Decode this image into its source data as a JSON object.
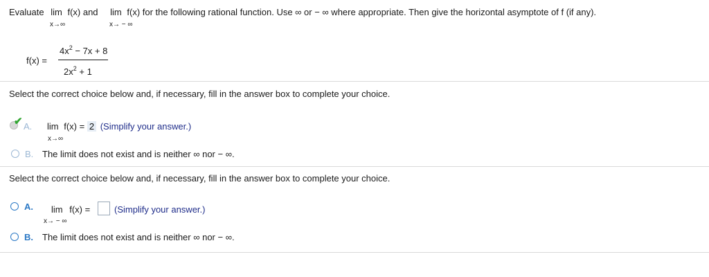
{
  "question": {
    "intro": "Evaluate",
    "lim1": "lim",
    "fx1": "f(x) and",
    "lim2": "lim",
    "rest": "f(x) for the following rational function. Use ∞ or − ∞ where appropriate. Then give the horizontal asymptote of f (if any).",
    "sub1": "x→∞",
    "sub2": "x→ − ∞"
  },
  "function": {
    "label": "f(x) =",
    "numerator_a": "4x",
    "numerator_exp": "2",
    "numerator_b": " − 7x + 8",
    "denominator_a": "2x",
    "denominator_exp": "2",
    "denominator_b": " + 1"
  },
  "part1": {
    "instruction": "Select the correct choice below and, if necessary, fill in the answer box to complete your choice.",
    "choice_a": {
      "letter": "A.",
      "lim": "lim",
      "fx": "f(x) =",
      "answer": "2",
      "hint": "(Simplify your answer.)",
      "sub": "x→∞"
    },
    "choice_b": {
      "letter": "B.",
      "text": "The limit does not exist and is neither ∞ nor − ∞."
    }
  },
  "part2": {
    "instruction": "Select the correct choice below and, if necessary, fill in the answer box to complete your choice.",
    "choice_a": {
      "letter": "A.",
      "lim": "lim",
      "fx": "f(x) =",
      "answer": "",
      "hint": "(Simplify your answer.)",
      "sub": "x→ − ∞"
    },
    "choice_b": {
      "letter": "B.",
      "text": "The limit does not exist and is neither ∞ nor − ∞."
    }
  },
  "colors": {
    "link_blue": "#2a78c5",
    "hint_navy": "#1f2d8a",
    "correct_green": "#2fa52f"
  }
}
